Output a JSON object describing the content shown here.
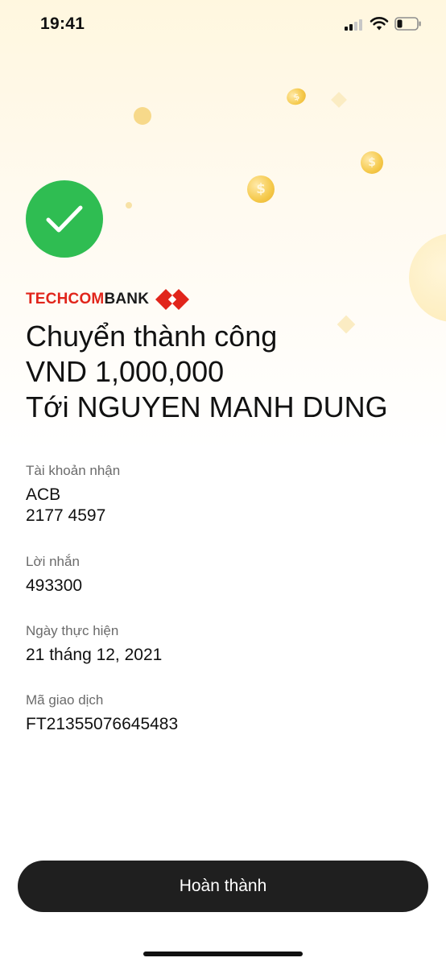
{
  "status_bar": {
    "time": "19:41"
  },
  "bank": {
    "name_red": "TECHCOM",
    "name_dark": "BANK",
    "brand_color": "#e1251b"
  },
  "result": {
    "line1": "Chuyển thành công",
    "line2": "VND 1,000,000",
    "line3": "Tới NGUYEN MANH DUNG",
    "success_color": "#2fbd52"
  },
  "details": {
    "account_label": "Tài khoản nhận",
    "account_bank": "ACB",
    "account_number": "2177 4597",
    "message_label": "Lời nhắn",
    "message_value": "493300",
    "date_label": "Ngày thực hiện",
    "date_value": "21 tháng 12, 2021",
    "txn_label": "Mã giao dịch",
    "txn_value": "FT21355076645483"
  },
  "actions": {
    "done_label": "Hoàn thành"
  },
  "icons": {
    "check": "check-icon",
    "coin": "dollar-coin-icon"
  }
}
